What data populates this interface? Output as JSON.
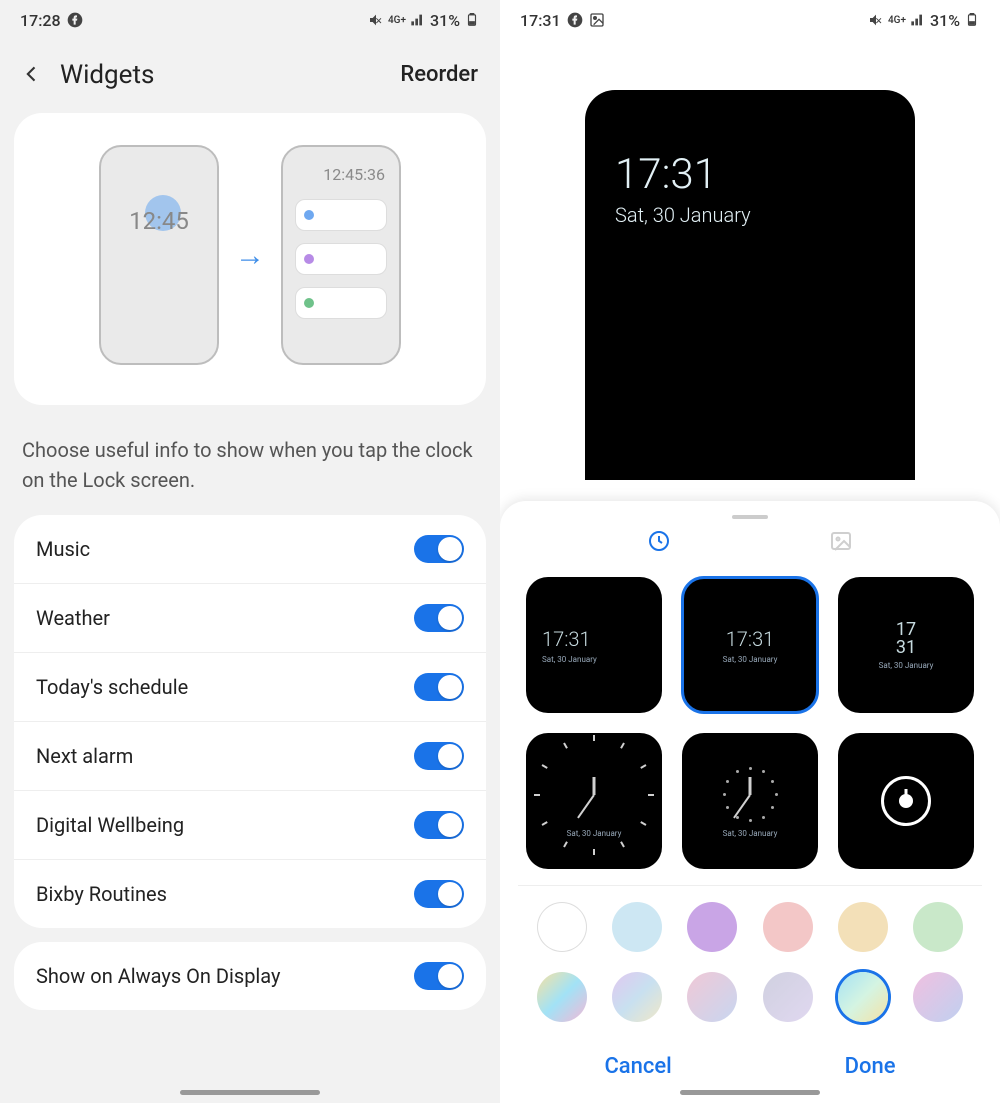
{
  "left": {
    "status": {
      "time": "17:28",
      "network": "4G+",
      "battery": "31%"
    },
    "header": {
      "title": "Widgets",
      "action": "Reorder"
    },
    "illus": {
      "clock": "12:45",
      "clock_sec": "12:45:36"
    },
    "desc": "Choose useful info to show when you tap the clock on the Lock screen.",
    "items": [
      {
        "label": "Music",
        "on": true
      },
      {
        "label": "Weather",
        "on": true
      },
      {
        "label": "Today's schedule",
        "on": true
      },
      {
        "label": "Next alarm",
        "on": true
      },
      {
        "label": "Digital Wellbeing",
        "on": true
      },
      {
        "label": "Bixby Routines",
        "on": true
      }
    ],
    "aod": {
      "label": "Show on Always On Display",
      "on": true
    }
  },
  "right": {
    "status": {
      "time": "17:31",
      "network": "4G+",
      "battery": "31%"
    },
    "preview": {
      "time": "17:31",
      "date": "Sat, 30 January"
    },
    "clock_styles": [
      {
        "time": "17:31",
        "date": "Sat, 30 January",
        "layout": "left",
        "selected": false
      },
      {
        "time": "17:31",
        "date": "Sat, 30 January",
        "layout": "center",
        "selected": true
      },
      {
        "time": "17",
        "time2": "31",
        "date": "Sat, 30 January",
        "layout": "stack",
        "selected": false
      },
      {
        "layout": "analog-ticks",
        "date": "Sat, 30 January",
        "selected": false
      },
      {
        "layout": "analog-dots",
        "date": "Sat, 30 January",
        "selected": false
      },
      {
        "layout": "simple",
        "selected": false
      }
    ],
    "colors": [
      {
        "bg": "#ffffff",
        "ring": true
      },
      {
        "bg": "#cde7f3"
      },
      {
        "bg": "#c9a5e6"
      },
      {
        "bg": "#f3c7c7"
      },
      {
        "bg": "#f3e0b8"
      },
      {
        "bg": "#c9e8c9"
      },
      {
        "bg": "linear-gradient(135deg,#f6e1a2,#a2e2f6,#f3b8d6)"
      },
      {
        "bg": "linear-gradient(135deg,#e0c8f0,#c8e0f0,#f0e8c8)"
      },
      {
        "bg": "linear-gradient(135deg,#f0c8d6,#c8d6f0)"
      },
      {
        "bg": "linear-gradient(135deg,#d0d0e0,#e0d8f0)"
      },
      {
        "bg": "linear-gradient(135deg,#a5e2f4,#d4f4e2,#f4e2a5)",
        "selected": true
      },
      {
        "bg": "linear-gradient(135deg,#f0c0e0,#c0d0f0)"
      }
    ],
    "buttons": {
      "cancel": "Cancel",
      "done": "Done"
    }
  }
}
